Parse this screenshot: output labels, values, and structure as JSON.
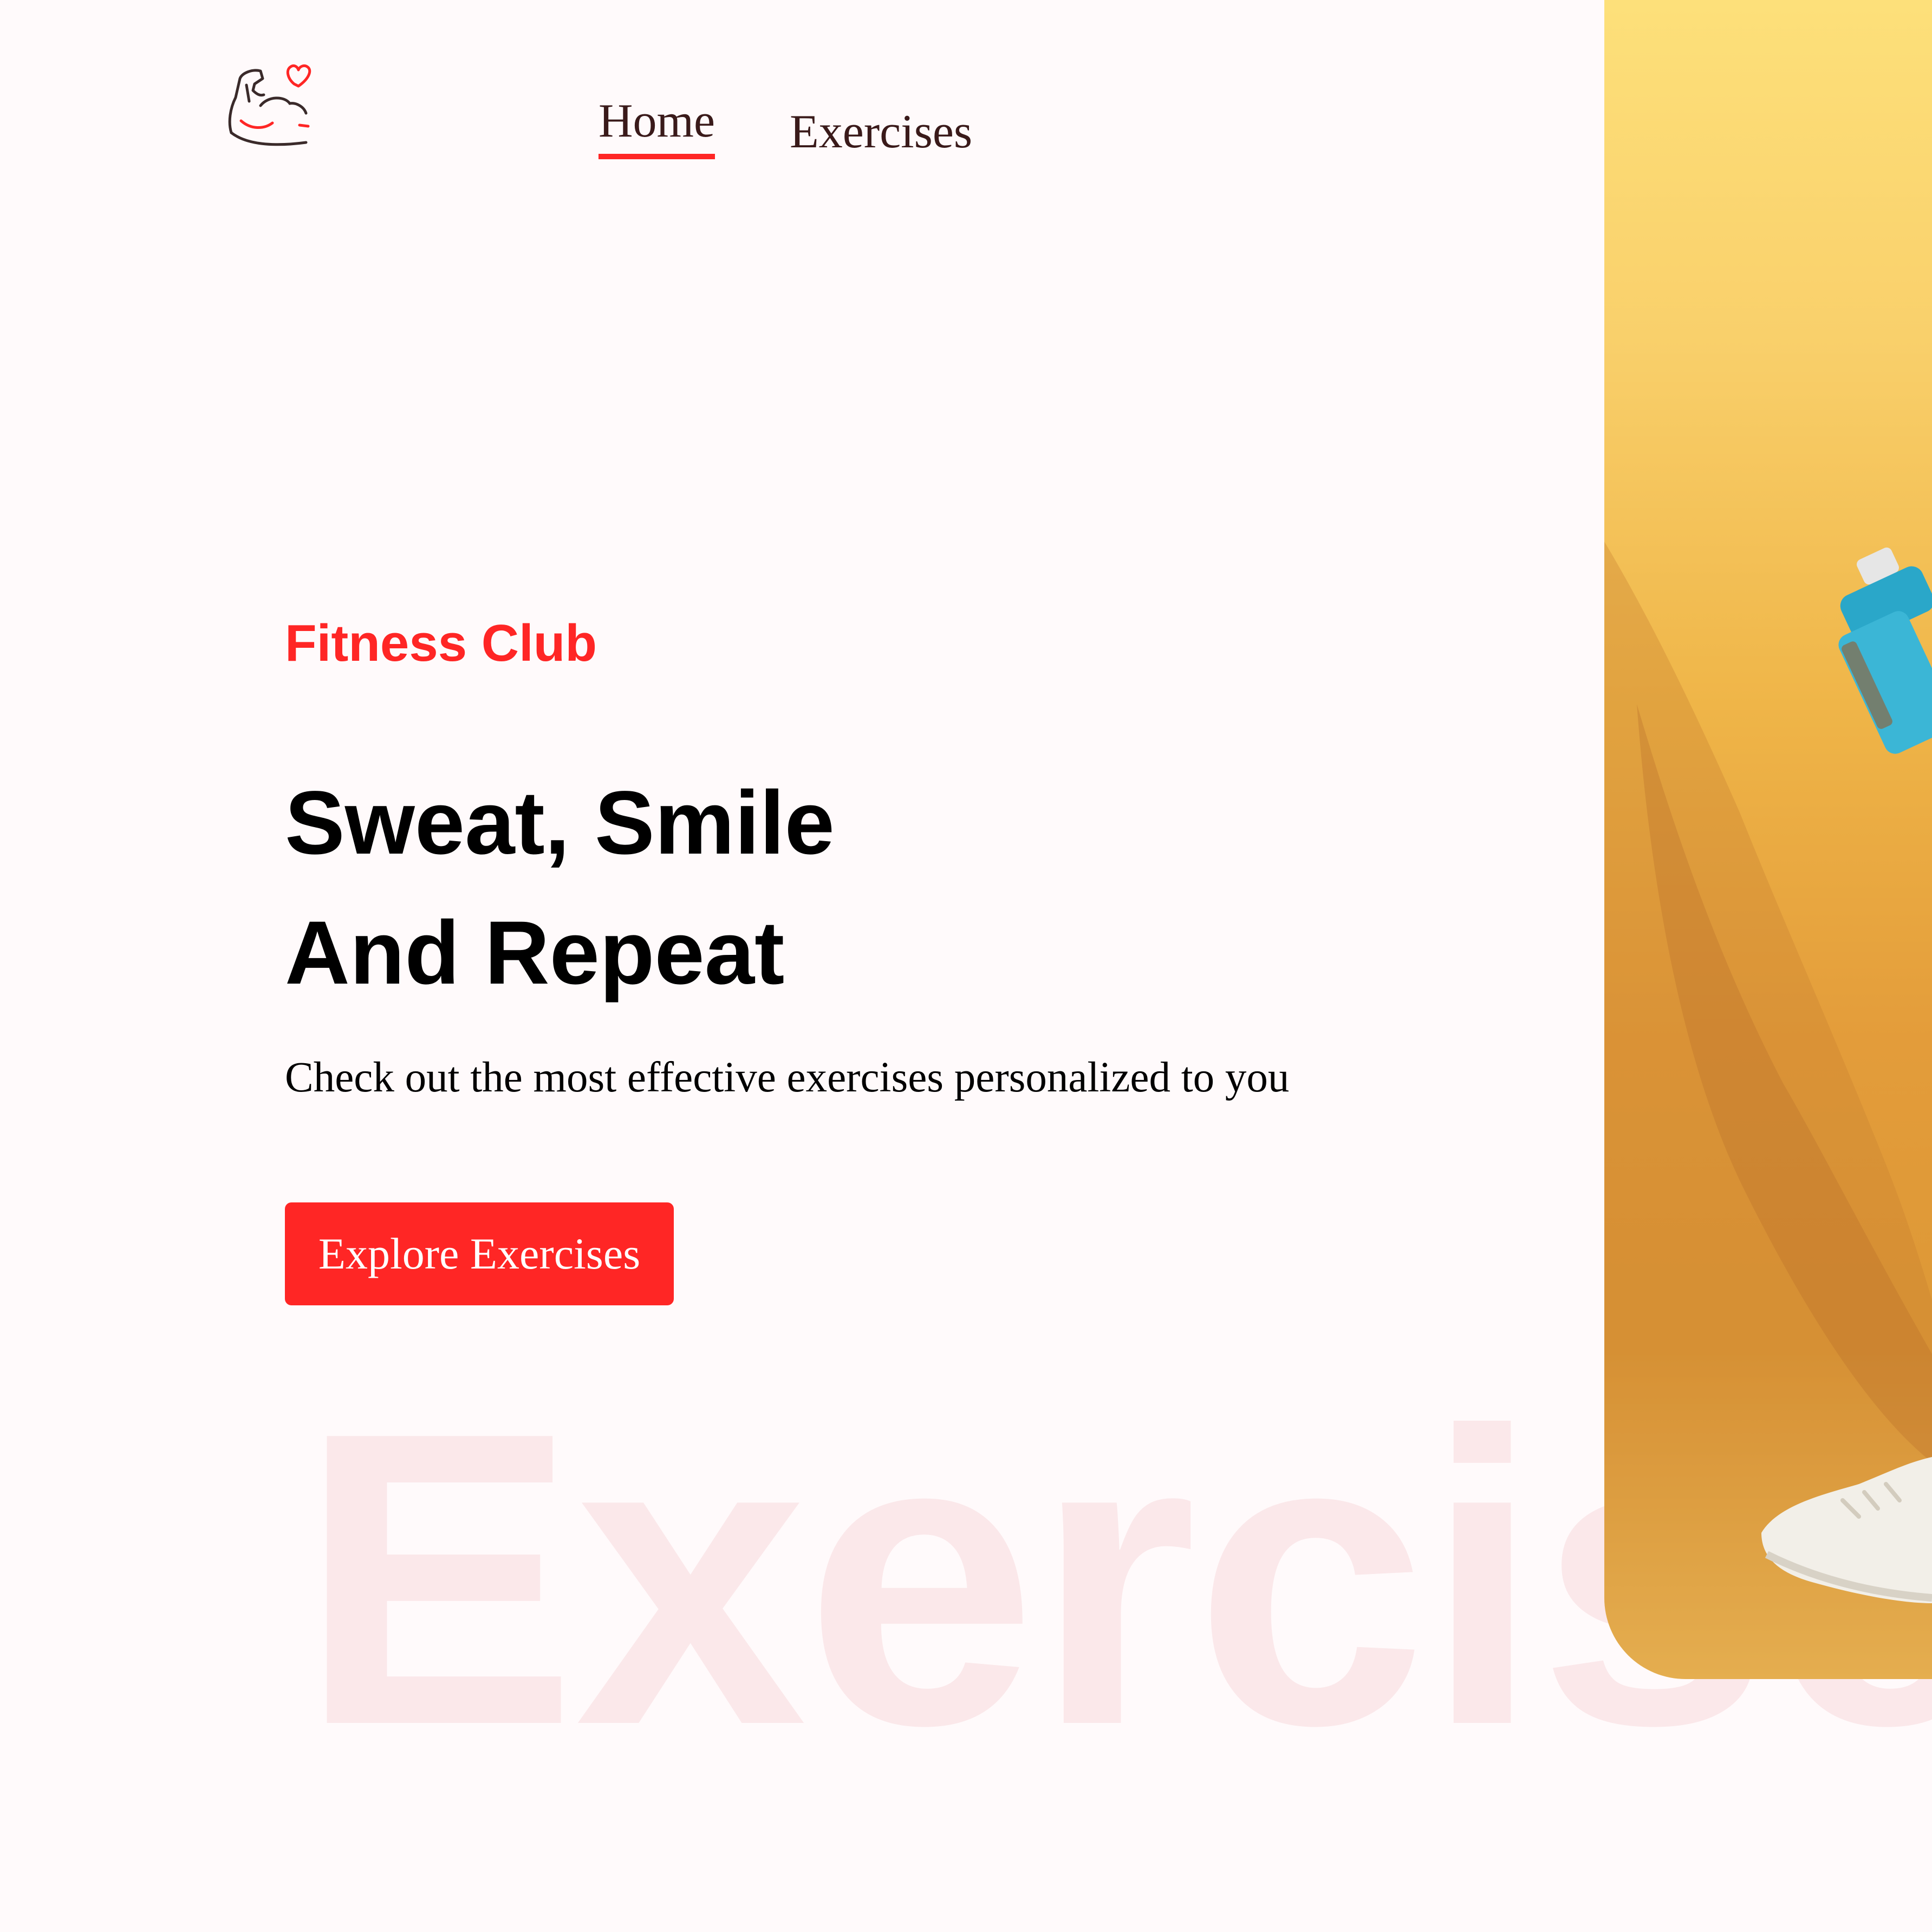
{
  "brand": {
    "logo_icon": "flexed-arm-heart-icon",
    "accent_color": "#ff2625"
  },
  "nav": {
    "items": [
      {
        "label": "Home",
        "active": true
      },
      {
        "label": "Exercises",
        "active": false
      }
    ]
  },
  "hero": {
    "eyebrow": "Fitness Club",
    "title_line1": "Sweat, Smile",
    "title_line2": "And Repeat",
    "subtitle": "Check out the most effective exercises personalized to you",
    "cta_label": "Explore Exercises",
    "watermark": "Exercise",
    "image_icon": "fitness-banner-photo"
  }
}
